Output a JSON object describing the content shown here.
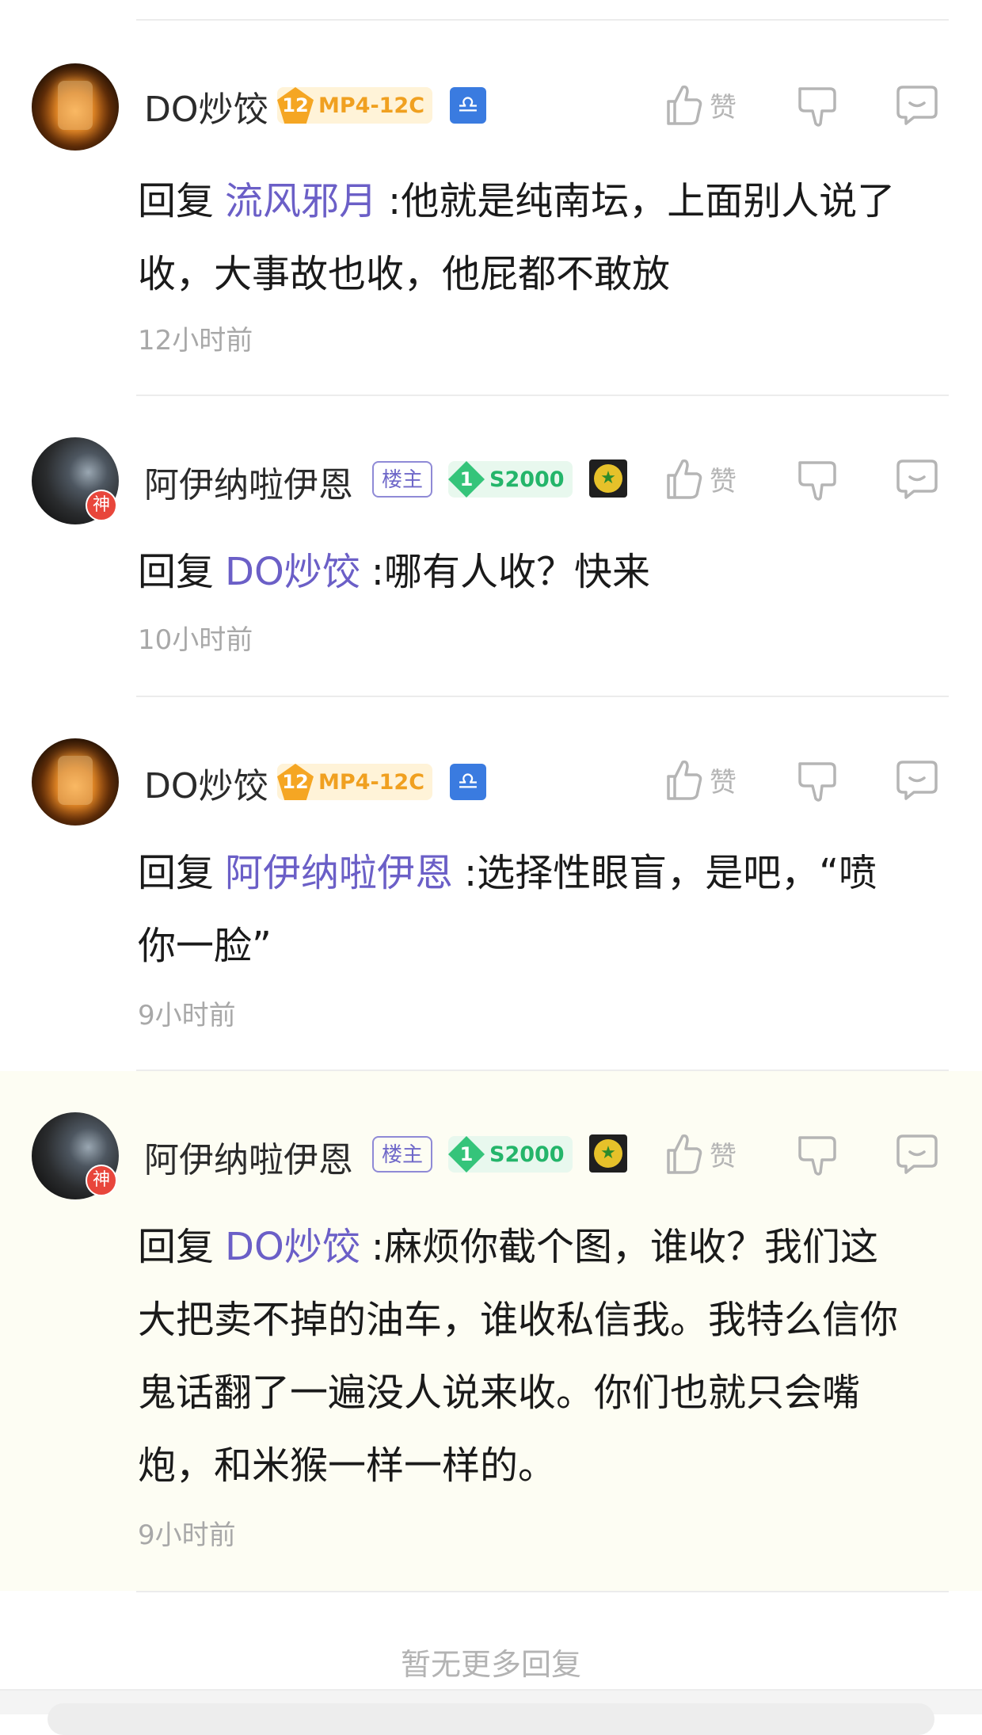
{
  "comments": [
    {
      "username": "DO炒饺",
      "level": "12",
      "badge": "MP4-12C",
      "zodiac": "♎",
      "like_label": "赞",
      "reply_prefix": "回复",
      "mention": "流风邪月",
      "text_line1": ":他就是纯南坛，上面别人说了",
      "text_line2": "收，大事故也收，他屁都不敢放",
      "time": "12小时前"
    },
    {
      "username": "阿伊纳啦伊恩",
      "op_tag": "楼主",
      "level": "1",
      "badge": "S2000",
      "god_badge": "神",
      "like_label": "赞",
      "reply_prefix": "回复",
      "mention": "DO炒饺",
      "text_line1": ":哪有人收？快来",
      "time": "10小时前"
    },
    {
      "username": "DO炒饺",
      "level": "12",
      "badge": "MP4-12C",
      "zodiac": "♎",
      "like_label": "赞",
      "reply_prefix": "回复",
      "mention": "阿伊纳啦伊恩",
      "text_line1": ":选择性眼盲，是吧，“喷",
      "text_line2": "你一脸”",
      "time": "9小时前"
    },
    {
      "username": "阿伊纳啦伊恩",
      "op_tag": "楼主",
      "level": "1",
      "badge": "S2000",
      "god_badge": "神",
      "like_label": "赞",
      "reply_prefix": "回复",
      "mention": "DO炒饺",
      "text_line1": ":麻烦你截个图，谁收？我们这",
      "text_line2": "大把卖不掉的油车，谁收私信我。我特么信你",
      "text_line3": "鬼话翻了一遍没人说来收。你们也就只会嘴",
      "text_line4": "炮，和米猴一样一样的。",
      "time": "9小时前"
    }
  ],
  "footer": {
    "no_more": "暂无更多回复"
  },
  "colors": {
    "mention": "#6b5fc7",
    "highlight_bg": "#fdfdf3"
  }
}
